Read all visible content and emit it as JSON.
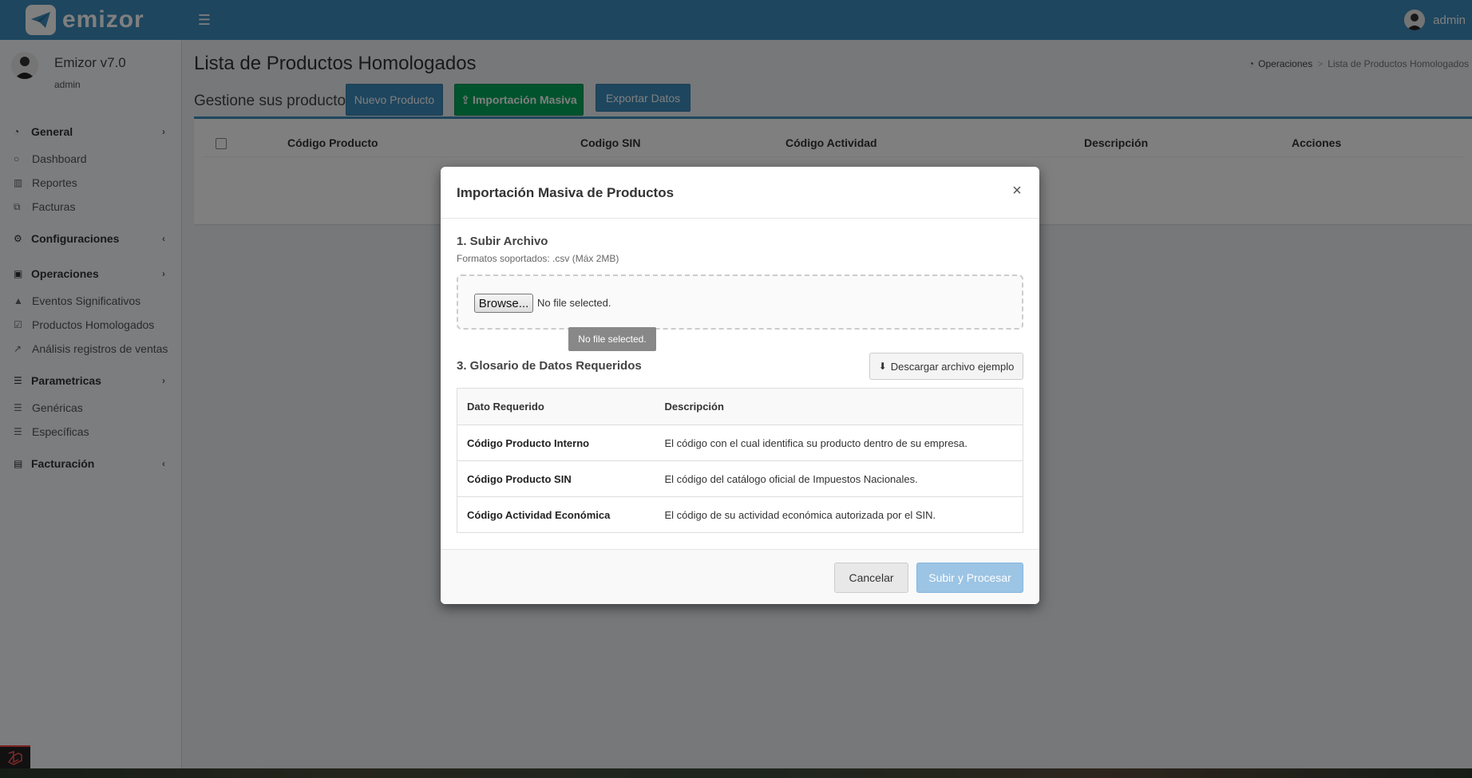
{
  "header": {
    "logo_text": "emizor",
    "user_name": "admin"
  },
  "sidebar": {
    "app_name": "Emizor v7.0",
    "user_role": "admin",
    "sections": [
      {
        "label": "General",
        "icon": "dashboard-icon",
        "chevron": "right",
        "items": [
          {
            "label": "Dashboard",
            "icon": "circle-icon"
          },
          {
            "label": "Reportes",
            "icon": "bar-chart-icon"
          },
          {
            "label": "Facturas",
            "icon": "copy-icon"
          }
        ]
      },
      {
        "label": "Configuraciones",
        "icon": "gears-icon",
        "chevron": "left",
        "items": []
      },
      {
        "label": "Operaciones",
        "icon": "briefcase-icon",
        "chevron": "right",
        "items": [
          {
            "label": "Eventos Significativos",
            "icon": "warning-icon"
          },
          {
            "label": "Productos Homologados",
            "icon": "check-square-icon"
          },
          {
            "label": "Análisis registros de ventas",
            "icon": "line-chart-icon"
          }
        ]
      },
      {
        "label": "Parametricas",
        "icon": "sliders-icon",
        "chevron": "right",
        "items": [
          {
            "label": "Genéricas",
            "icon": "list-icon"
          },
          {
            "label": "Específicas",
            "icon": "list-icon"
          }
        ]
      },
      {
        "label": "Facturación",
        "icon": "file-icon",
        "chevron": "left",
        "items": []
      }
    ]
  },
  "page": {
    "title": "Lista de Productos Homologados",
    "breadcrumb": [
      "Operaciones",
      "Lista de Productos Homologados"
    ],
    "subtitle": "Gestione sus productos",
    "buttons": {
      "new": "Nuevo Producto",
      "import": "Importación Masiva",
      "export": "Exportar Datos"
    },
    "table_headers": [
      "Código Producto",
      "Codigo SIN",
      "Código Actividad",
      "Descripción",
      "Acciones"
    ]
  },
  "modal": {
    "title": "Importación Masiva de Productos",
    "close": "×",
    "step1_title": "1. Subir Archivo",
    "step1_hint": "Formatos soportados: .csv (Máx 2MB)",
    "browse_label": "Browse...",
    "file_status": "No file selected.",
    "tooltip": "No file selected.",
    "step3_title": "3. Glosario de Datos Requeridos",
    "download_label": "Descargar archivo ejemplo",
    "glossary_headers": [
      "Dato Requerido",
      "Descripción"
    ],
    "glossary_rows": [
      {
        "key": "Código Producto Interno",
        "desc": "El código con el cual identifica su producto dentro de su empresa."
      },
      {
        "key": "Código Producto SIN",
        "desc": "El código del catálogo oficial de Impuestos Nacionales."
      },
      {
        "key": "Código Actividad Económica",
        "desc": "El código de su actividad económica autorizada por el SIN."
      }
    ],
    "cancel_label": "Cancelar",
    "submit_label": "Subir y Procesar"
  },
  "colors": {
    "primary": "#3c8dbc",
    "success": "#00a65a",
    "sidebar_bg": "#f9fafc"
  }
}
